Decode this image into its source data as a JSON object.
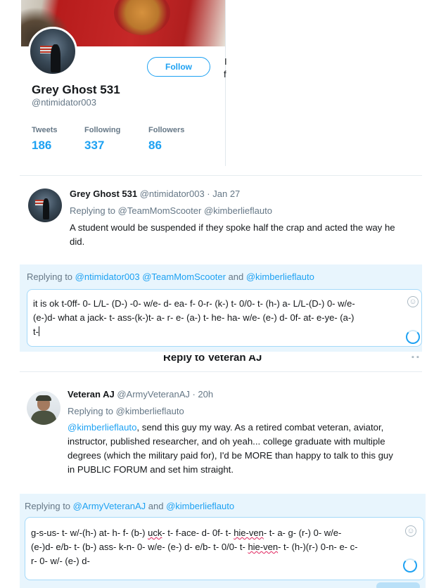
{
  "profile": {
    "name": "Grey Ghost 531",
    "handle": "@ntimidator003",
    "follow_label": "Follow",
    "stats": [
      {
        "label": "Tweets",
        "value": "186"
      },
      {
        "label": "Following",
        "value": "337"
      },
      {
        "label": "Followers",
        "value": "86"
      }
    ],
    "clipped_chars": [
      "I",
      "f"
    ]
  },
  "tweets": [
    {
      "name": "Grey Ghost 531",
      "meta": "@ntimidator003 · Jan 27",
      "replying_prefix": "Replying to ",
      "replying_to": "@TeamMomScooter @kimberlieflauto",
      "body_lines": [
        "A student would be suspended if they spoke half the crap and acted the way he",
        "did."
      ]
    },
    {
      "name": "Veteran AJ",
      "meta": "@ArmyVeteranAJ · 20h",
      "replying_prefix": "Replying to ",
      "replying_to": "@kimberlieflauto",
      "body_mention": "@kimberlieflauto",
      "body_lines": [
        ", send this guy my way. As a retired combat veteran, aviator,",
        "instructor, published researcher, and oh yeah... college graduate with multiple",
        "degrees (which the military paid for), I'd be MORE than happy to talk to this guy",
        "in PUBLIC FORUM and set him straight."
      ]
    }
  ],
  "composers": [
    {
      "replying_prefix": "Replying to ",
      "mentions_a": "@ntimidator003 @TeamMomScooter",
      "joiner": " and ",
      "mentions_b": "@kimberlieflauto",
      "lines": [
        "it is ok t-0ff- 0- L/L- (D-) -0- w/e- d- ea- f- 0-r- (k-) t- 0/0- t- (h-) a- L/L-(D-) 0- w/e-",
        "(e-)d-    what a jack- t- ass-(k-)t- a- r- e- (a-) t- he- ha- w/e- (e-) d- 0f- at- e-ye- (a-)",
        "t-"
      ]
    },
    {
      "replying_prefix": "Replying to ",
      "mentions_a": "@ArmyVeteranAJ",
      "joiner": " and ",
      "mentions_b": "@kimberlieflauto",
      "line1_a": "g-s-us- t- w/-(h-) at- h- f- (b-) ",
      "line1_b": "uck",
      "line1_c": "- t- f-ace- d- 0f- t- ",
      "line1_d": "hie-ven",
      "line1_e": "- t- a- g- (r-) 0- w/e-",
      "line2_a": "(e-)d- e/b- t- (b-) ass- k-n- 0- w/e- (e-) d- e/b- t- 0/0- t- ",
      "line2_b": "hie-ven",
      "line2_c": "- t- (h-)(r-) 0-n- e- c-",
      "line3": "r- 0- w/- (e-) d-"
    }
  ],
  "cut_heading": "Reply to Veteran AJ",
  "emoji_glyph": "☺"
}
